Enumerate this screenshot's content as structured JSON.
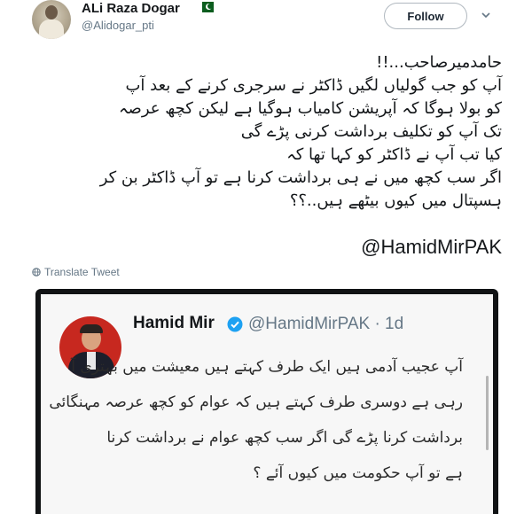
{
  "tweet": {
    "user_name": "ALi Raza Dogar",
    "handle": "@Alidogar_pti",
    "follow_label": "Follow",
    "text_lines": [
      "حامدمیرصاحب...!!",
      "آپ کو جب گولیاں لگیں ڈاکٹر نے سرجری کرنے کے بعد آپ",
      "کو بولا ہوگا کہ آپریشن کامیاب ہوگیا ہے لیکن کچھ عرصہ",
      "تک آپ کو تکلیف برداشت کرنی پڑے گی",
      "کیا تب آپ نے ڈاکٹر کو کہا تھا کہ",
      "اگر سب کچھ میں نے ہی برداشت کرنا ہے تو آپ ڈاکٹر بن کر",
      "ہسپتال میں کیوں بیٹھے ہیں..؟؟"
    ],
    "mention": "@HamidMirPAK",
    "translate_label": "Translate Tweet"
  },
  "quoted": {
    "name": "Hamid Mir",
    "handle_time": "@HamidMirPAK · 1d",
    "text_lines": [
      "آپ عجیب آدمی ہیں ایک طرف کہتے ہیں معیشت میں بہتری آ",
      "رہی ہے دوسری طرف کہتے ہیں کہ عوام کو کچھ عرصہ مہنگائی",
      "برداشت کرنا پڑے گی اگر سب کچھ عوام نے برداشت کرنا",
      "ہے تو آپ حکومت میں کیوں آئے ؟"
    ]
  },
  "colors": {
    "text": "#14171a",
    "muted": "#657786",
    "verified": "#1da1f2",
    "flag_green": "#0b5d1e"
  },
  "icons": [
    "flag-icon",
    "chevron-down-icon",
    "globe-icon",
    "verified-icon"
  ]
}
